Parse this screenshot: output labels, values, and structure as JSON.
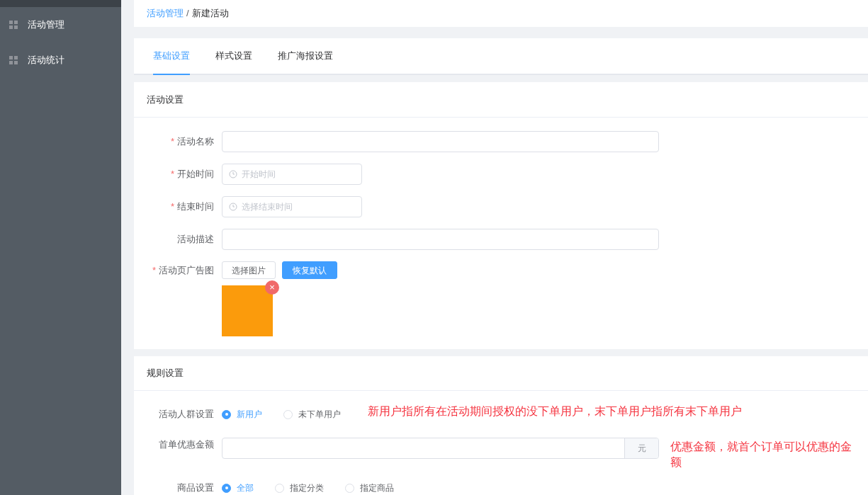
{
  "sidebar": {
    "items": [
      {
        "label": "活动管理",
        "selected": false
      },
      {
        "label": "活动统计",
        "selected": false
      }
    ]
  },
  "breadcrumb": [
    {
      "label": "活动管理",
      "link": true
    },
    {
      "label": "新建活动",
      "link": false
    }
  ],
  "breadcrumb_separator": "/",
  "tabs": [
    {
      "label": "基础设置",
      "selected": true
    },
    {
      "label": "样式设置",
      "selected": false
    },
    {
      "label": "推广海报设置",
      "selected": false
    }
  ],
  "activity_settings": {
    "title": "活动设置",
    "fields": [
      {
        "kind": "text",
        "label": "活动名称",
        "required_mark": "*"
      },
      {
        "kind": "time",
        "label": "开始时间",
        "required_mark": "*",
        "placeholder": "开始时间"
      },
      {
        "kind": "time",
        "label": "结束时间",
        "required_mark": "*",
        "placeholder": "选择结束时间"
      },
      {
        "kind": "text",
        "label": "活动描述"
      },
      {
        "kind": "image",
        "label": "活动页广告图",
        "required_mark": "*",
        "buttons": [
          {
            "label": "选择图片",
            "primary": false
          },
          {
            "label": "恢复默认",
            "primary": true
          }
        ],
        "remove_icon": "×"
      }
    ]
  },
  "rule_settings": {
    "title": "规则设置",
    "fields": [
      {
        "kind": "radio",
        "label": "活动人群设置",
        "options": [
          {
            "label": "新用户",
            "selected": true
          },
          {
            "label": "未下单用户",
            "selected": false
          }
        ],
        "note": "新用户指所有在活动期间授权的没下单用户，末下单用户指所有末下单用户"
      },
      {
        "kind": "amount",
        "label": "首单优惠金额",
        "suffix": "元",
        "note": "优惠金额，就首个订单可以优惠的金额"
      },
      {
        "kind": "radio",
        "label": "商品设置",
        "options": [
          {
            "label": "全部",
            "selected": true
          },
          {
            "label": "指定分类",
            "selected": false
          },
          {
            "label": "指定商品",
            "selected": false
          }
        ]
      }
    ]
  }
}
